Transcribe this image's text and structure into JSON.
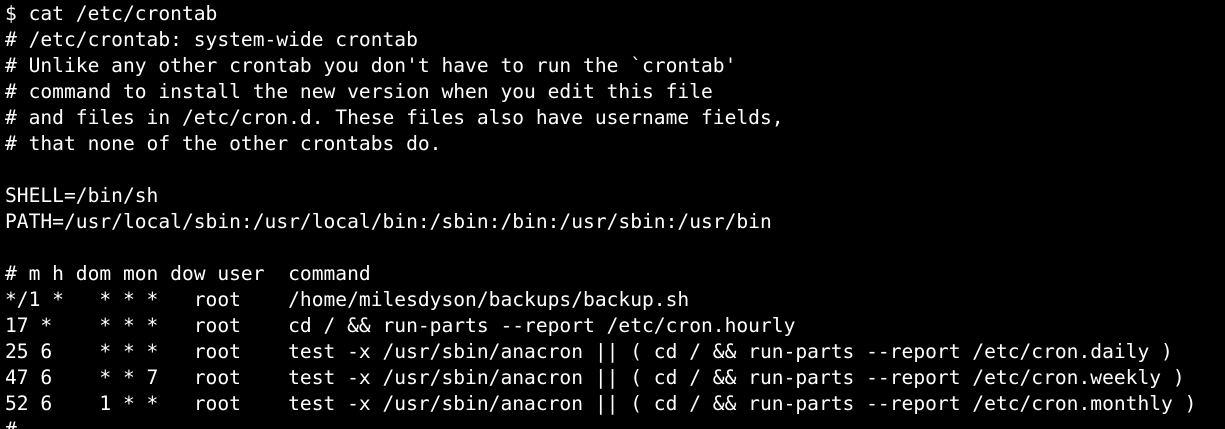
{
  "terminal": {
    "lines": [
      "$ cat /etc/crontab",
      "# /etc/crontab: system-wide crontab",
      "# Unlike any other crontab you don't have to run the `crontab'",
      "# command to install the new version when you edit this file",
      "# and files in /etc/cron.d. These files also have username fields,",
      "# that none of the other crontabs do.",
      "",
      "SHELL=/bin/sh",
      "PATH=/usr/local/sbin:/usr/local/bin:/sbin:/bin:/usr/sbin:/usr/bin",
      "",
      "# m h dom mon dow user  command",
      "*/1 *   * * *   root    /home/milesdyson/backups/backup.sh",
      "17 *    * * *   root    cd / && run-parts --report /etc/cron.hourly",
      "25 6    * * *   root    test -x /usr/sbin/anacron || ( cd / && run-parts --report /etc/cron.daily )",
      "47 6    * * 7   root    test -x /usr/sbin/anacron || ( cd / && run-parts --report /etc/cron.weekly )",
      "52 6    1 * *   root    test -x /usr/sbin/anacron || ( cd / && run-parts --report /etc/cron.monthly )",
      "#"
    ]
  }
}
